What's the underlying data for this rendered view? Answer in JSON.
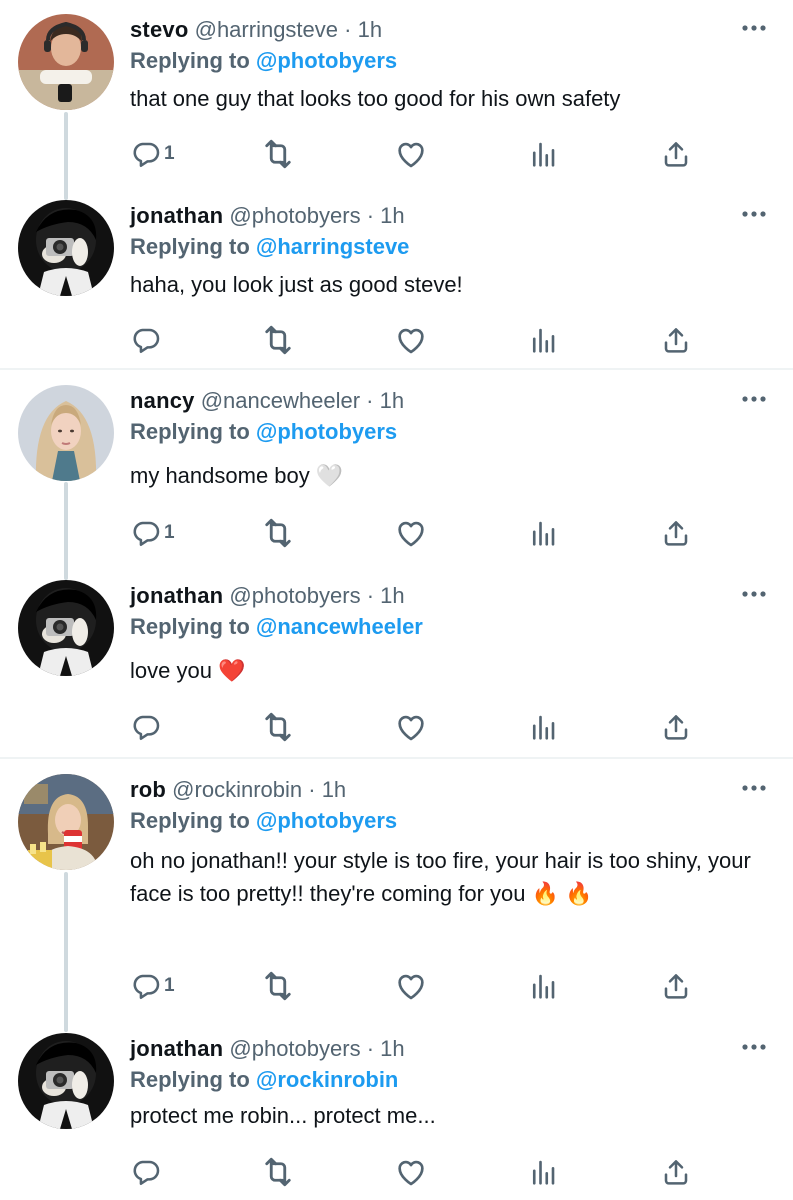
{
  "colors": {
    "accent": "#1d9bf0",
    "muted": "#536471",
    "text": "#0f1419",
    "thread_line": "#cfd9de"
  },
  "tweets": [
    {
      "name": "stevo",
      "handle": "@harringsteve",
      "dot": "·",
      "time": "1h",
      "reply_label": "Replying to",
      "reply_to": "@photobyers",
      "text": "that one guy that looks too good for his own safety",
      "reply_count": "1",
      "avatar": "steve-avatar"
    },
    {
      "name": "jonathan",
      "handle": "@photobyers",
      "dot": "·",
      "time": "1h",
      "reply_label": "Replying to",
      "reply_to": "@harringsteve",
      "text": "haha, you look just as good steve!",
      "reply_count": "",
      "avatar": "jonathan-avatar"
    },
    {
      "name": "nancy",
      "handle": "@nancewheeler",
      "dot": "·",
      "time": "1h",
      "reply_label": "Replying to",
      "reply_to": "@photobyers",
      "text": "my handsome boy 🤍",
      "reply_count": "1",
      "avatar": "nancy-avatar"
    },
    {
      "name": "jonathan",
      "handle": "@photobyers",
      "dot": "·",
      "time": "1h",
      "reply_label": "Replying to",
      "reply_to": "@nancewheeler",
      "text": "love you ❤️",
      "reply_count": "",
      "avatar": "jonathan-avatar"
    },
    {
      "name": "rob",
      "handle": "@rockinrobin",
      "dot": "·",
      "time": "1h",
      "reply_label": "Replying to",
      "reply_to": "@photobyers",
      "text": "oh no jonathan!! your style is too fire, your hair is too shiny, your face is too pretty!! they're coming for you 🔥 🔥",
      "reply_count": "1",
      "avatar": "robin-avatar"
    },
    {
      "name": "jonathan",
      "handle": "@photobyers",
      "dot": "·",
      "time": "1h",
      "reply_label": "Replying to",
      "reply_to": "@rockinrobin",
      "text": "protect me robin... protect me...",
      "reply_count": "",
      "avatar": "jonathan-avatar"
    }
  ],
  "icons": {
    "reply": "reply-icon",
    "retweet": "retweet-icon",
    "like": "heart-icon",
    "views": "views-icon",
    "share": "share-icon",
    "more": "more-icon"
  }
}
